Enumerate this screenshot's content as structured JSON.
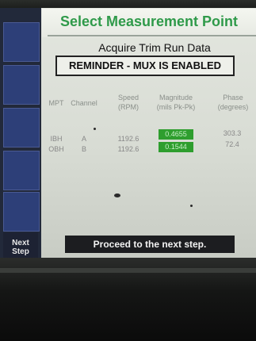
{
  "header": {
    "title": "Select Measurement Point",
    "subtitle": "Acquire Trim Run Data",
    "reminder": "REMINDER - MUX IS ENABLED"
  },
  "table": {
    "headers": {
      "mpt": "MPT",
      "channel": "Channel",
      "speed_line1": "Speed",
      "speed_line2": "(RPM)",
      "magnitude_line1": "Magnitude",
      "magnitude_line2": "(mils Pk-Pk)",
      "phase_line1": "Phase",
      "phase_line2": "(degrees)"
    },
    "rows": [
      {
        "mpt": "IBH",
        "channel": "A",
        "speed": "1192.6",
        "magnitude": "0.4655",
        "phase": "303.3"
      },
      {
        "mpt": "OBH",
        "channel": "B",
        "speed": "1192.6",
        "magnitude": "0.1544",
        "phase": "72.4"
      }
    ]
  },
  "sidebar": {
    "next_step_line1": "Next",
    "next_step_line2": "Step"
  },
  "status": {
    "message": "Proceed to the next step."
  },
  "colors": {
    "title_green": "#2f9a4a",
    "magnitude_highlight": "#2e9e2e",
    "softkey_blue": "#2d3f78"
  }
}
